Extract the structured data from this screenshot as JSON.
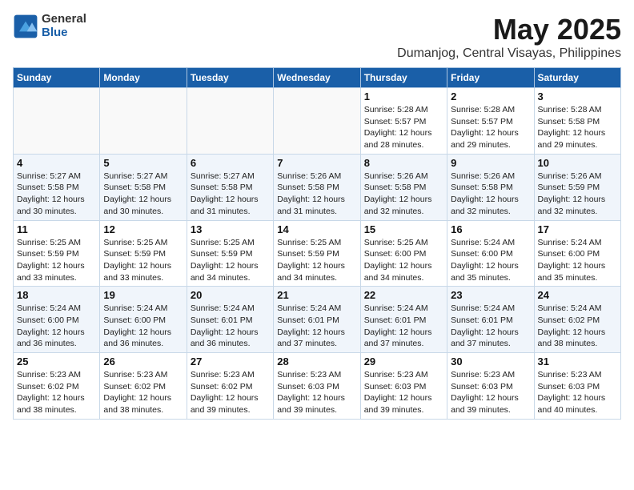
{
  "header": {
    "logo_general": "General",
    "logo_blue": "Blue",
    "month_title": "May 2025",
    "location": "Dumanjog, Central Visayas, Philippines"
  },
  "weekdays": [
    "Sunday",
    "Monday",
    "Tuesday",
    "Wednesday",
    "Thursday",
    "Friday",
    "Saturday"
  ],
  "weeks": [
    [
      {
        "day": "",
        "info": ""
      },
      {
        "day": "",
        "info": ""
      },
      {
        "day": "",
        "info": ""
      },
      {
        "day": "",
        "info": ""
      },
      {
        "day": "1",
        "info": "Sunrise: 5:28 AM\nSunset: 5:57 PM\nDaylight: 12 hours\nand 28 minutes."
      },
      {
        "day": "2",
        "info": "Sunrise: 5:28 AM\nSunset: 5:57 PM\nDaylight: 12 hours\nand 29 minutes."
      },
      {
        "day": "3",
        "info": "Sunrise: 5:28 AM\nSunset: 5:58 PM\nDaylight: 12 hours\nand 29 minutes."
      }
    ],
    [
      {
        "day": "4",
        "info": "Sunrise: 5:27 AM\nSunset: 5:58 PM\nDaylight: 12 hours\nand 30 minutes."
      },
      {
        "day": "5",
        "info": "Sunrise: 5:27 AM\nSunset: 5:58 PM\nDaylight: 12 hours\nand 30 minutes."
      },
      {
        "day": "6",
        "info": "Sunrise: 5:27 AM\nSunset: 5:58 PM\nDaylight: 12 hours\nand 31 minutes."
      },
      {
        "day": "7",
        "info": "Sunrise: 5:26 AM\nSunset: 5:58 PM\nDaylight: 12 hours\nand 31 minutes."
      },
      {
        "day": "8",
        "info": "Sunrise: 5:26 AM\nSunset: 5:58 PM\nDaylight: 12 hours\nand 32 minutes."
      },
      {
        "day": "9",
        "info": "Sunrise: 5:26 AM\nSunset: 5:58 PM\nDaylight: 12 hours\nand 32 minutes."
      },
      {
        "day": "10",
        "info": "Sunrise: 5:26 AM\nSunset: 5:59 PM\nDaylight: 12 hours\nand 32 minutes."
      }
    ],
    [
      {
        "day": "11",
        "info": "Sunrise: 5:25 AM\nSunset: 5:59 PM\nDaylight: 12 hours\nand 33 minutes."
      },
      {
        "day": "12",
        "info": "Sunrise: 5:25 AM\nSunset: 5:59 PM\nDaylight: 12 hours\nand 33 minutes."
      },
      {
        "day": "13",
        "info": "Sunrise: 5:25 AM\nSunset: 5:59 PM\nDaylight: 12 hours\nand 34 minutes."
      },
      {
        "day": "14",
        "info": "Sunrise: 5:25 AM\nSunset: 5:59 PM\nDaylight: 12 hours\nand 34 minutes."
      },
      {
        "day": "15",
        "info": "Sunrise: 5:25 AM\nSunset: 6:00 PM\nDaylight: 12 hours\nand 34 minutes."
      },
      {
        "day": "16",
        "info": "Sunrise: 5:24 AM\nSunset: 6:00 PM\nDaylight: 12 hours\nand 35 minutes."
      },
      {
        "day": "17",
        "info": "Sunrise: 5:24 AM\nSunset: 6:00 PM\nDaylight: 12 hours\nand 35 minutes."
      }
    ],
    [
      {
        "day": "18",
        "info": "Sunrise: 5:24 AM\nSunset: 6:00 PM\nDaylight: 12 hours\nand 36 minutes."
      },
      {
        "day": "19",
        "info": "Sunrise: 5:24 AM\nSunset: 6:00 PM\nDaylight: 12 hours\nand 36 minutes."
      },
      {
        "day": "20",
        "info": "Sunrise: 5:24 AM\nSunset: 6:01 PM\nDaylight: 12 hours\nand 36 minutes."
      },
      {
        "day": "21",
        "info": "Sunrise: 5:24 AM\nSunset: 6:01 PM\nDaylight: 12 hours\nand 37 minutes."
      },
      {
        "day": "22",
        "info": "Sunrise: 5:24 AM\nSunset: 6:01 PM\nDaylight: 12 hours\nand 37 minutes."
      },
      {
        "day": "23",
        "info": "Sunrise: 5:24 AM\nSunset: 6:01 PM\nDaylight: 12 hours\nand 37 minutes."
      },
      {
        "day": "24",
        "info": "Sunrise: 5:24 AM\nSunset: 6:02 PM\nDaylight: 12 hours\nand 38 minutes."
      }
    ],
    [
      {
        "day": "25",
        "info": "Sunrise: 5:23 AM\nSunset: 6:02 PM\nDaylight: 12 hours\nand 38 minutes."
      },
      {
        "day": "26",
        "info": "Sunrise: 5:23 AM\nSunset: 6:02 PM\nDaylight: 12 hours\nand 38 minutes."
      },
      {
        "day": "27",
        "info": "Sunrise: 5:23 AM\nSunset: 6:02 PM\nDaylight: 12 hours\nand 39 minutes."
      },
      {
        "day": "28",
        "info": "Sunrise: 5:23 AM\nSunset: 6:03 PM\nDaylight: 12 hours\nand 39 minutes."
      },
      {
        "day": "29",
        "info": "Sunrise: 5:23 AM\nSunset: 6:03 PM\nDaylight: 12 hours\nand 39 minutes."
      },
      {
        "day": "30",
        "info": "Sunrise: 5:23 AM\nSunset: 6:03 PM\nDaylight: 12 hours\nand 39 minutes."
      },
      {
        "day": "31",
        "info": "Sunrise: 5:23 AM\nSunset: 6:03 PM\nDaylight: 12 hours\nand 40 minutes."
      }
    ]
  ]
}
